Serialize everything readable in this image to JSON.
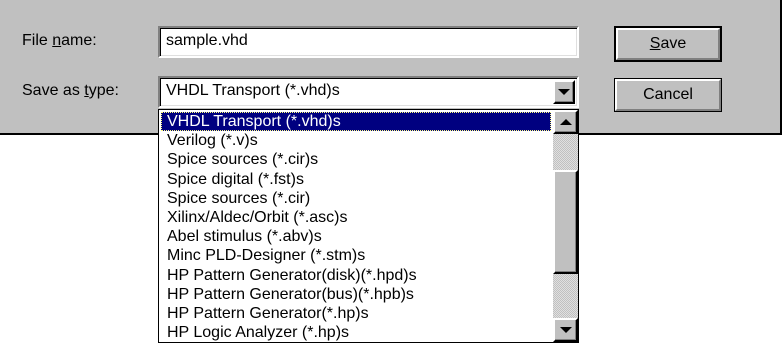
{
  "dialog": {
    "file_name_label_pre": "File ",
    "file_name_label_key": "n",
    "file_name_label_post": "ame:",
    "save_as_type_label_pre": "Save as ",
    "save_as_type_label_key": "t",
    "save_as_type_label_post": "ype:",
    "file_name_value": "sample.vhd",
    "save_as_type_value": "VHDL Transport (*.vhd)s",
    "save_button_key": "S",
    "save_button_rest": "ave",
    "cancel_button": "Cancel"
  },
  "type_list": {
    "selected_index": 0,
    "items": [
      "VHDL Transport (*.vhd)s",
      "Verilog (*.v)s",
      "Spice sources (*.cir)s",
      "Spice digital (*.fst)s",
      "Spice sources (*.cir)",
      "Xilinx/Aldec/Orbit (*.asc)s",
      "Abel stimulus (*.abv)s",
      "Minc PLD-Designer (*.stm)s",
      "HP Pattern Generator(disk)(*.hpd)s",
      "HP Pattern Generator(bus)(*.hpb)s",
      "HP Pattern Generator(*.hp)s",
      "HP Logic Analyzer (*.hp)s"
    ],
    "scroll_fraction": 0
  },
  "icons": {
    "dropdown": "chevron-down-icon",
    "scroll_up": "arrow-up-icon",
    "scroll_down": "arrow-down-icon"
  },
  "colors": {
    "dialog_bg": "#c0c0c0",
    "selection_bg": "#000080",
    "selection_fg": "#ffffff"
  }
}
